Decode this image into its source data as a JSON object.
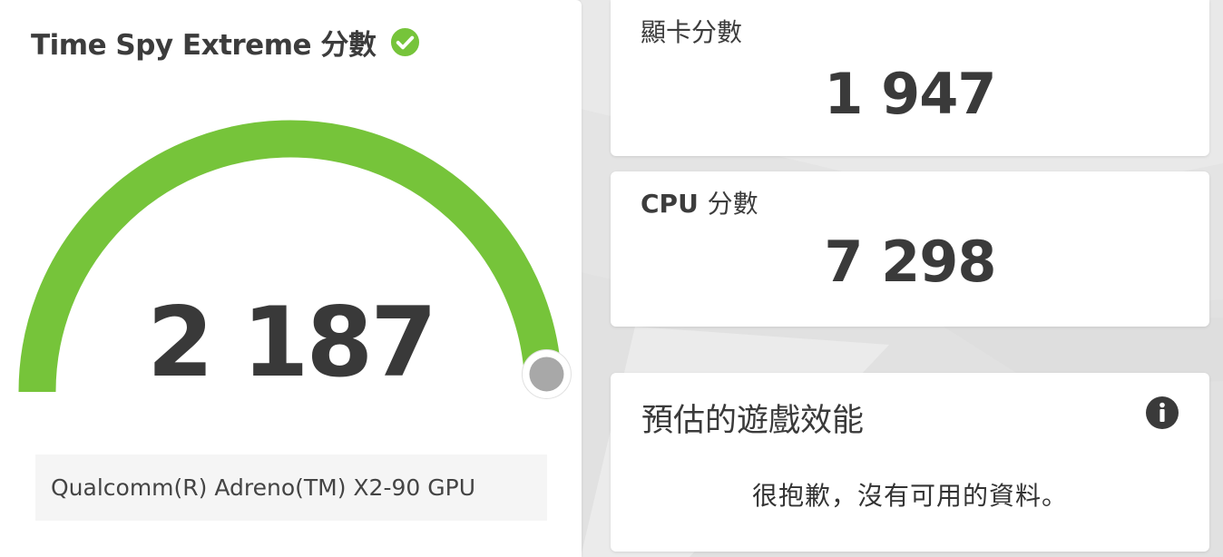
{
  "main": {
    "title": "Time Spy Extreme 分數",
    "score": "2 187",
    "gauge_fraction": 0.98,
    "device": "Qualcomm(R) Adreno(TM) X2-90 GPU",
    "check_icon": "check-circle-icon"
  },
  "gpu": {
    "label": "顯卡分數",
    "score": "1 947"
  },
  "cpu": {
    "label_prefix": "CPU",
    "label_suffix": "分數",
    "score": "7 298"
  },
  "performance": {
    "title": "預估的遊戲效能",
    "message": "很抱歉，沒有可用的資料。",
    "info_icon": "info-icon"
  },
  "colors": {
    "accent_green": "#76c43a",
    "background": "#e4e4e4",
    "card": "#ffffff",
    "knob": "#a8a8a8"
  }
}
